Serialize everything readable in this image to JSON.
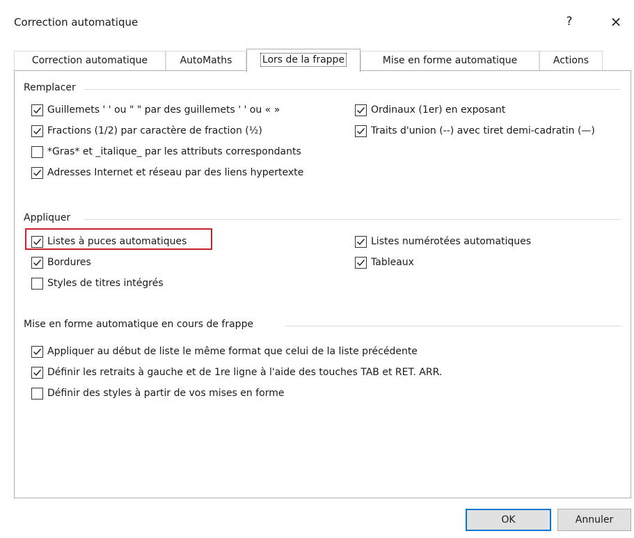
{
  "window": {
    "title": "Correction automatique",
    "help_label": "?",
    "close_label": "×"
  },
  "tabs": [
    {
      "label": "Correction automatique"
    },
    {
      "label": "AutoMaths"
    },
    {
      "label": "Lors de la frappe",
      "active": true
    },
    {
      "label": "Mise en forme automatique"
    },
    {
      "label": "Actions"
    }
  ],
  "groups": {
    "replace": {
      "legend": "Remplacer",
      "options": [
        {
          "label": "Guillemets ' ' ou \" \" par des guillemets ' ' ou « »",
          "checked": true
        },
        {
          "label": "Fractions (1/2) par caractère de fraction (½)",
          "checked": true
        },
        {
          "label": "*Gras* et _italique_ par les attributs correspondants",
          "checked": false
        },
        {
          "label": "Adresses Internet et réseau par des liens hypertexte",
          "checked": true
        },
        {
          "label": "Ordinaux (1er) en exposant",
          "checked": true
        },
        {
          "label": "Traits d'union (--) avec tiret demi-cadratin (—)",
          "checked": true
        }
      ]
    },
    "apply": {
      "legend": "Appliquer",
      "options": [
        {
          "label": "Listes à puces automatiques",
          "checked": true,
          "highlighted": true
        },
        {
          "label": "Bordures",
          "checked": true
        },
        {
          "label": "Styles de titres intégrés",
          "checked": false
        },
        {
          "label": "Listes numérotées automatiques",
          "checked": true
        },
        {
          "label": "Tableaux",
          "checked": true
        }
      ]
    },
    "autoformat": {
      "legend": "Mise en forme automatique en cours de frappe",
      "options": [
        {
          "label": "Appliquer au début de liste le même format que celui de la liste précédente",
          "checked": true
        },
        {
          "label": "Définir les retraits à gauche et de 1re ligne à l'aide des touches TAB et RET. ARR.",
          "checked": true
        },
        {
          "label": "Définir des styles à partir de vos mises en forme",
          "checked": false
        }
      ]
    }
  },
  "buttons": {
    "ok": "OK",
    "cancel": "Annuler"
  },
  "colors": {
    "highlight": "#c8202c",
    "default_button_border": "#0078d7",
    "button_bg": "#e1e1e1"
  }
}
